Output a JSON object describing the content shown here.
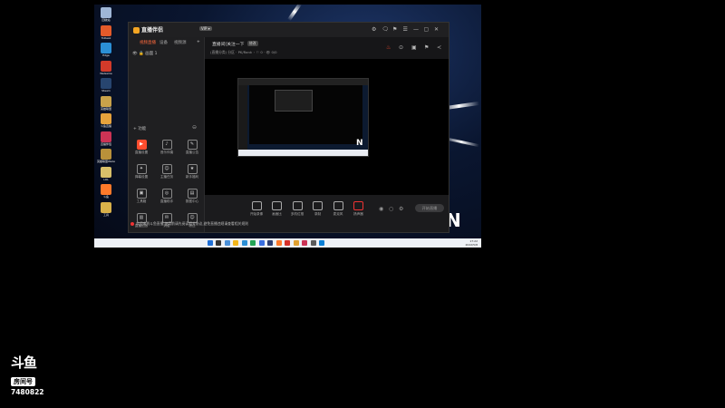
{
  "desktop": {
    "icons": [
      {
        "label": "回收站",
        "color": "#9fb6d6"
      },
      {
        "label": "ToDesk",
        "color": "#e35a2a"
      },
      {
        "label": "Edge",
        "color": "#2b8fd6"
      },
      {
        "label": "WeGame",
        "color": "#d23a2a"
      },
      {
        "label": "Steam",
        "color": "#27456f"
      },
      {
        "label": "英雄联盟",
        "color": "#c9a24a"
      },
      {
        "label": "斗鱼直播",
        "color": "#e6a23c"
      },
      {
        "label": "直播伴侣",
        "color": "#cc3355"
      },
      {
        "label": "英雄联盟WeGame",
        "color": "#b9913a"
      },
      {
        "label": "LOL",
        "color": "#d9c06a"
      },
      {
        "label": "斗鱼",
        "color": "#ff7a2a"
      },
      {
        "label": "工具",
        "color": "#d9b14a"
      }
    ],
    "taskbar": {
      "clock_time": "17:22",
      "clock_date": "2022/5/8",
      "icon_colors": [
        "#1f6fd6",
        "#333333",
        "#4a90d9",
        "#f2b51a",
        "#2b8fd6",
        "#23a455",
        "#3a6fe0",
        "#2d3e72",
        "#ff7a2a",
        "#d6312a",
        "#e0a030",
        "#cc3355",
        "#5b5b5b",
        "#0a7fd6"
      ]
    },
    "corner_logo": "N"
  },
  "app": {
    "name": "直播伴侣",
    "badge": "VIP ▾",
    "window_controls": [
      "⚙",
      "🗨",
      "⚑",
      "☰",
      "—",
      "▢",
      "✕"
    ],
    "left_tabs": [
      "视频直播",
      "设备",
      "视频源",
      "+"
    ],
    "scene": {
      "eye": "👁",
      "lock": "🔒",
      "name": "画面 1"
    },
    "tools_heading": "+ 功能",
    "tools": [
      {
        "icon": "▶",
        "label": "直播设置",
        "hot": true
      },
      {
        "icon": "♪",
        "label": "音乐伴奏",
        "hot": false
      },
      {
        "icon": "✎",
        "label": "直播公告",
        "hot": false
      },
      {
        "icon": "✦",
        "label": "弹幕设置",
        "hot": false
      },
      {
        "icon": "☺",
        "label": "主播任务",
        "hot": false
      },
      {
        "icon": "★",
        "label": "新手福利",
        "hot": false
      },
      {
        "icon": "▣",
        "label": "工具箱",
        "hot": false
      },
      {
        "icon": "◎",
        "label": "直播助手",
        "hot": false
      },
      {
        "icon": "▤",
        "label": "数据中心",
        "hot": false
      },
      {
        "icon": "▥",
        "label": "直播回放",
        "hot": false
      },
      {
        "icon": "✉",
        "label": "消息",
        "hot": false
      },
      {
        "icon": "☺",
        "label": "粉丝",
        "hot": false
      }
    ],
    "room": {
      "title": "直播间(关注一下",
      "tag": "修改",
      "meta": "(直播分类) 分区 · PK/Rank ◦ ⚐ 0 · 👁 0/0",
      "top_icons": [
        "♨",
        "⊙",
        "▣",
        "⚑",
        "≺"
      ]
    },
    "bottom_controls": [
      {
        "label": "开始录像"
      },
      {
        "label": "画面比"
      },
      {
        "label": "多机位推"
      },
      {
        "label": "录制"
      },
      {
        "label": "麦克风"
      },
      {
        "label": "扬声器"
      }
    ],
    "start_live_label": "开始直播",
    "notice": "欢迎来到斗鱼直播,使用前请先阅读相关协议,避免直播违规请查看相关规则"
  },
  "watermark": {
    "logo": "斗鱼",
    "room_label": "房间号",
    "room_id": "7480822"
  }
}
